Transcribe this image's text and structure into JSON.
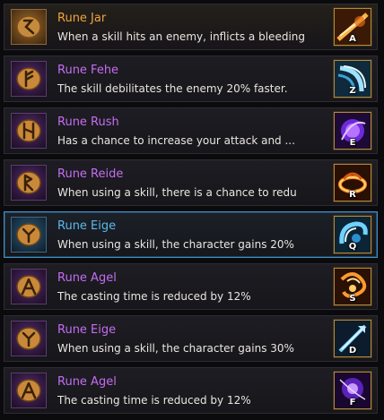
{
  "colors": {
    "gold_name": "#f0a53a",
    "purple_name": "#c56df2",
    "blue_name": "#5ab9ee",
    "desc_text": "#e9e6e0",
    "selected_border": "#3f8fc8"
  },
  "runes": [
    {
      "name": "Rune Jar",
      "name_color": "gold",
      "rune_icon": "gold-rune-stone-icon",
      "description": "When a skill hits an enemy, inflicts a bleeding",
      "skill_icon": "fire-slash-skill-icon",
      "hotkey": "A"
    },
    {
      "name": "Rune Fehe",
      "name_color": "purple",
      "rune_icon": "purple-rune-stone-icon",
      "description": "The skill debilitates the enemy 20% faster.",
      "skill_icon": "ice-wave-skill-icon",
      "hotkey": "Z"
    },
    {
      "name": "Rune Rush",
      "name_color": "purple",
      "rune_icon": "purple-rune-stone-icon",
      "description": "Has a chance to increase your attack and ...",
      "skill_icon": "arcane-orb-skill-icon",
      "hotkey": "E"
    },
    {
      "name": "Rune Reide",
      "name_color": "purple",
      "rune_icon": "purple-rune-stone-icon",
      "description": "When using a skill, there is a chance to redu",
      "skill_icon": "fire-ring-skill-icon",
      "hotkey": "R"
    },
    {
      "name": "Rune Eige",
      "name_color": "blue",
      "rune_icon": "blue-rune-stone-icon",
      "description": "When using a skill, the character gains 20%",
      "skill_icon": "water-swirl-skill-icon",
      "hotkey": "Q",
      "selected": true
    },
    {
      "name": "Rune Agel",
      "name_color": "purple",
      "rune_icon": "purple-rune-stone-icon",
      "description": "The casting time is reduced by 12%",
      "skill_icon": "fire-vortex-skill-icon",
      "hotkey": "S"
    },
    {
      "name": "Rune Eige",
      "name_color": "purple",
      "rune_icon": "purple-rune-stone-icon",
      "description": "When using a skill, the character gains 30%",
      "skill_icon": "ice-spear-skill-icon",
      "hotkey": "D"
    },
    {
      "name": "Rune Agel",
      "name_color": "purple",
      "rune_icon": "purple-rune-stone-icon",
      "description": "The casting time is reduced by 12%",
      "skill_icon": "void-orb-skill-icon",
      "hotkey": "F"
    }
  ]
}
